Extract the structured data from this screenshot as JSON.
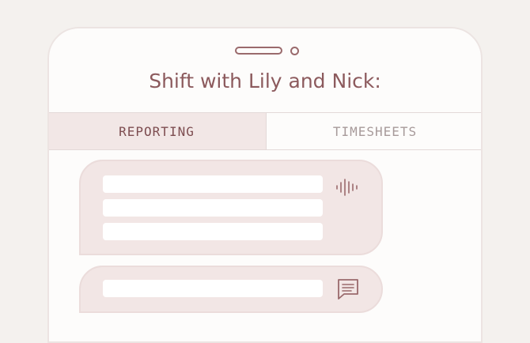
{
  "header": {
    "title": "Shift with Lily and Nick:"
  },
  "tabs": [
    {
      "label": "REPORTING",
      "active": true
    },
    {
      "label": "TIMESHEETS",
      "active": false
    }
  ],
  "messages": [
    {
      "kind": "audio",
      "icon": "audio-waveform-icon",
      "text_lines": 3
    },
    {
      "kind": "text",
      "icon": "chat-message-icon",
      "text_lines": 1
    }
  ],
  "colors": {
    "background": "#f4f1ee",
    "phone": "#fdfcfb",
    "accent": "#8c5a5d",
    "active_tab": "#f2e7e6",
    "bubble": "#f2e6e5"
  }
}
